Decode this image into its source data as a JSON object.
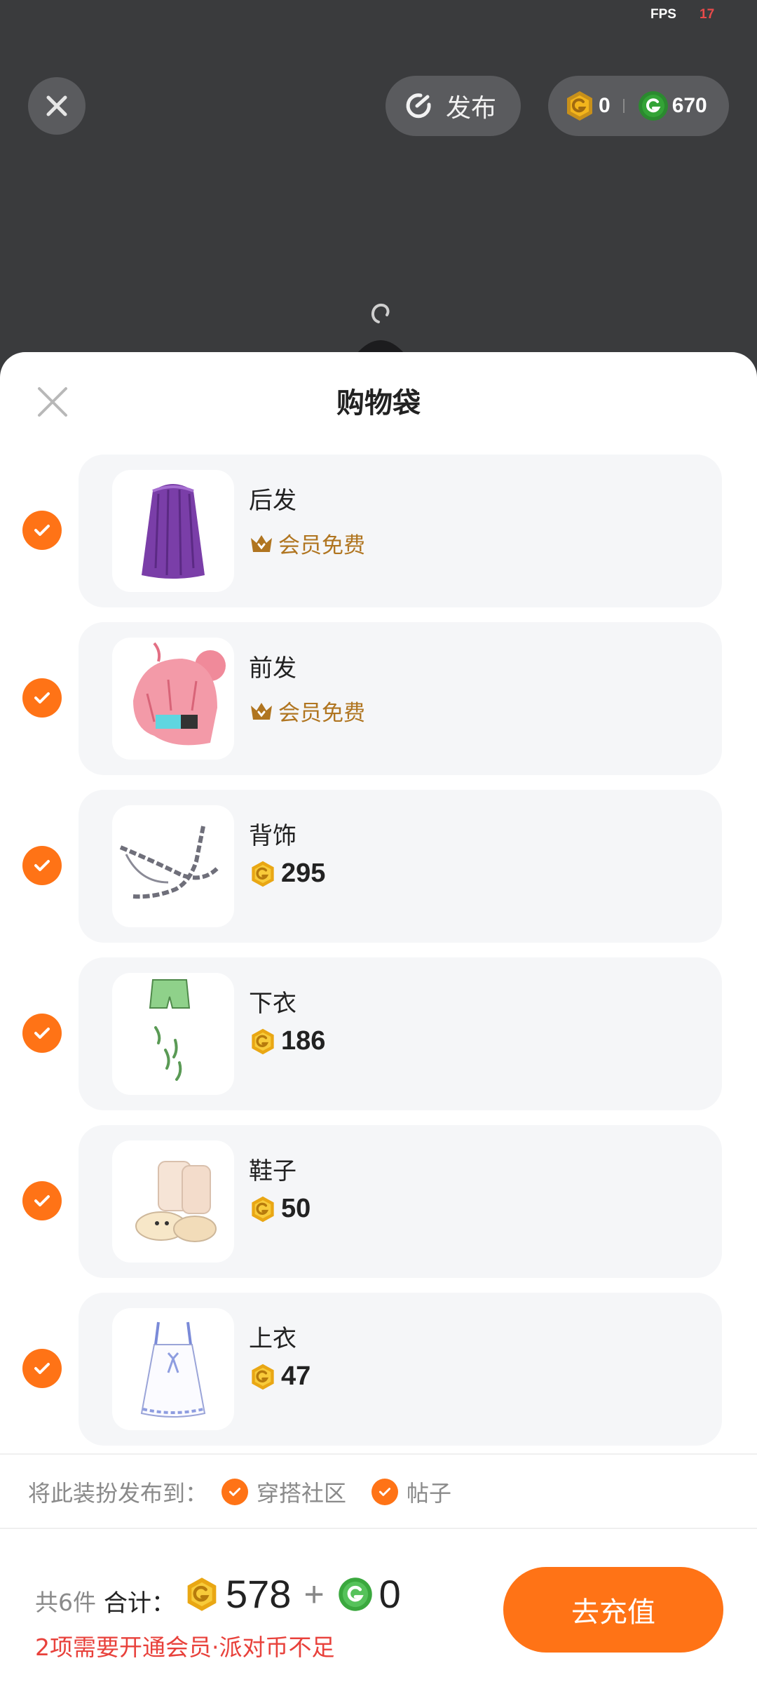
{
  "status": {
    "fps_label": "FPS",
    "fps_value": "17"
  },
  "topbar": {
    "publish_label": "发布",
    "gold_balance": "0",
    "green_balance": "670"
  },
  "sheet": {
    "title": "购物袋",
    "items": [
      {
        "name": "后发",
        "badge": "会员免费",
        "type": "vip"
      },
      {
        "name": "前发",
        "badge": "会员免费",
        "type": "vip"
      },
      {
        "name": "背饰",
        "price": "295",
        "type": "coin"
      },
      {
        "name": "下衣",
        "price": "186",
        "type": "coin"
      },
      {
        "name": "鞋子",
        "price": "50",
        "type": "coin"
      },
      {
        "name": "上衣",
        "price": "47",
        "type": "coin"
      }
    ],
    "publish_to_label": "将此装扮发布到：",
    "publish_options": [
      "穿搭社区",
      "帖子"
    ]
  },
  "footer": {
    "count": "共6件",
    "total_label": "合计：",
    "gold_total": "578",
    "plus": "+",
    "green_total": "0",
    "warning": "2项需要开通会员·派对币不足",
    "recharge_label": "去充值"
  },
  "colors": {
    "accent": "#ff7316",
    "vip": "#b07520",
    "warning": "#e8413b",
    "coin_gold": "#f3b51c",
    "coin_green": "#33a336"
  }
}
